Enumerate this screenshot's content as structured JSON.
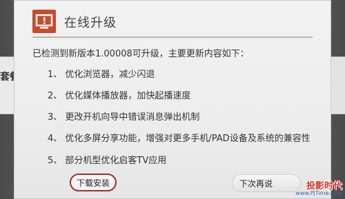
{
  "background": {
    "left_text": "套餐"
  },
  "dialog": {
    "icon": "tv-alert-icon",
    "title": "在线升级",
    "intro": "已检测到新版本1.00008可升级，主要更新内容如下：",
    "items": [
      "1、 优化浏览器，减少闪退",
      "2、 优化媒体播放器，加快起播速度",
      "3、 更改开机向导中错误消息弹出机制",
      "4、 优化多屏分享功能，增强对更多手机/PAD设备及系统的兼容性",
      "5、 部分机型优化启客TV应用"
    ],
    "buttons": {
      "download": "下载安装",
      "later": "下次再说"
    }
  },
  "watermark": {
    "text": "投影时代",
    "url": "www.PjTime.com"
  },
  "colors": {
    "accent": "#c84b2b",
    "button_border": "#a52a2a"
  }
}
